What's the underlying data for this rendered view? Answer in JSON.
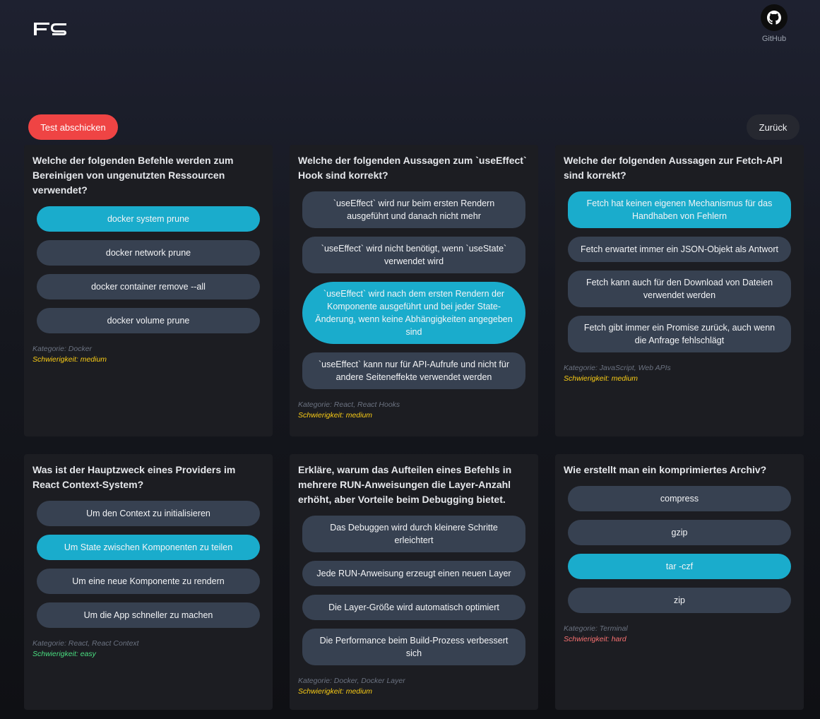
{
  "header": {
    "github_label": "GitHub"
  },
  "toolbar": {
    "submit_label": "Test abschicken",
    "back_label": "Zurück"
  },
  "questions": [
    {
      "question": "Welche der folgenden Befehle werden zum Bereinigen von ungenutzten Ressourcen verwendet?",
      "options": [
        {
          "label": "docker system prune",
          "selected": true
        },
        {
          "label": "docker network prune",
          "selected": false
        },
        {
          "label": "docker container remove --all",
          "selected": false
        },
        {
          "label": "docker volume prune",
          "selected": false
        }
      ],
      "category": "Kategorie: Docker",
      "difficulty": "Schwierigkeit: medium",
      "level": "medium"
    },
    {
      "question": "Welche der folgenden Aussagen zum `useEffect` Hook sind korrekt?",
      "options": [
        {
          "label": "`useEffect` wird nur beim ersten Rendern ausgeführt und danach nicht mehr",
          "selected": false
        },
        {
          "label": "`useEffect` wird nicht benötigt, wenn `useState` verwendet wird",
          "selected": false
        },
        {
          "label": "`useEffect` wird nach dem ersten Rendern der Komponente ausgeführt und bei jeder State-Änderung, wenn keine Abhängigkeiten angegeben sind",
          "selected": true
        },
        {
          "label": "`useEffect` kann nur für API-Aufrufe und nicht für andere Seiteneffekte verwendet werden",
          "selected": false
        }
      ],
      "category": "Kategorie: React, React Hooks",
      "difficulty": "Schwierigkeit: medium",
      "level": "medium"
    },
    {
      "question": "Welche der folgenden Aussagen zur Fetch-API sind korrekt?",
      "options": [
        {
          "label": "Fetch hat keinen eigenen Mechanismus für das Handhaben von Fehlern",
          "selected": true
        },
        {
          "label": "Fetch erwartet immer ein JSON-Objekt als Antwort",
          "selected": false
        },
        {
          "label": "Fetch kann auch für den Download von Dateien verwendet werden",
          "selected": false
        },
        {
          "label": "Fetch gibt immer ein Promise zurück, auch wenn die Anfrage fehlschlägt",
          "selected": false
        }
      ],
      "category": "Kategorie: JavaScript, Web APIs",
      "difficulty": "Schwierigkeit: medium",
      "level": "medium"
    },
    {
      "question": "Was ist der Hauptzweck eines Providers im React Context-System?",
      "options": [
        {
          "label": "Um den Context zu initialisieren",
          "selected": false
        },
        {
          "label": "Um State zwischen Komponenten zu teilen",
          "selected": true
        },
        {
          "label": "Um eine neue Komponente zu rendern",
          "selected": false
        },
        {
          "label": "Um die App schneller zu machen",
          "selected": false
        }
      ],
      "category": "Kategorie: React, React Context",
      "difficulty": "Schwierigkeit: easy",
      "level": "easy"
    },
    {
      "question": "Erkläre, warum das Aufteilen eines Befehls in mehrere RUN-Anweisungen die Layer-Anzahl erhöht, aber Vorteile beim Debugging bietet.",
      "options": [
        {
          "label": "Das Debuggen wird durch kleinere Schritte erleichtert",
          "selected": false
        },
        {
          "label": "Jede RUN-Anweisung erzeugt einen neuen Layer",
          "selected": false
        },
        {
          "label": "Die Layer-Größe wird automatisch optimiert",
          "selected": false
        },
        {
          "label": "Die Performance beim Build-Prozess verbessert sich",
          "selected": false
        }
      ],
      "category": "Kategorie: Docker, Docker Layer",
      "difficulty": "Schwierigkeit: medium",
      "level": "medium"
    },
    {
      "question": "Wie erstellt man ein komprimiertes Archiv?",
      "options": [
        {
          "label": "compress",
          "selected": false
        },
        {
          "label": "gzip",
          "selected": false
        },
        {
          "label": "tar -czf",
          "selected": true
        },
        {
          "label": "zip",
          "selected": false
        }
      ],
      "category": "Kategorie: Terminal",
      "difficulty": "Schwierigkeit: hard",
      "level": "hard"
    }
  ],
  "colors": {
    "accent": "#1aaccc",
    "danger": "#ef4444",
    "option": "#374151",
    "card": "#1c1d22"
  }
}
